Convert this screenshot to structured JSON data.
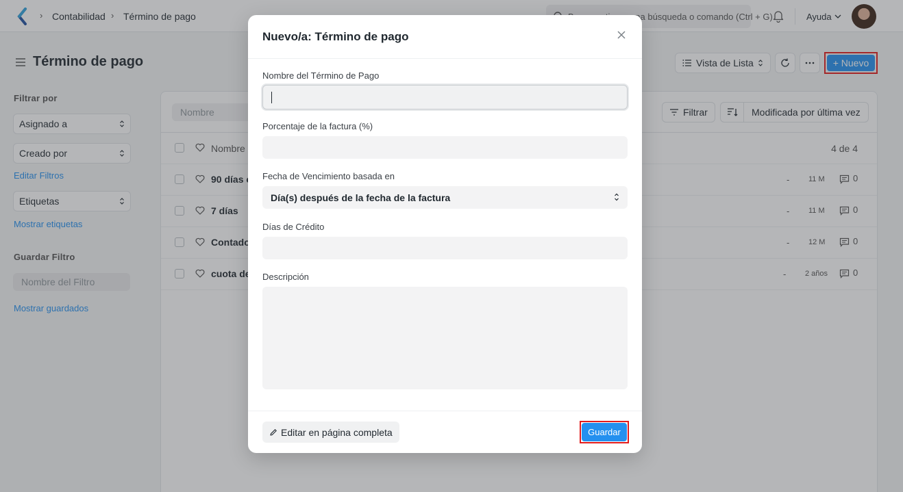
{
  "navbar": {
    "breadcrumbs": [
      "Contabilidad",
      "Término de pago"
    ],
    "search_placeholder": "Buscar o tipear una búsqueda o comando (Ctrl + G)",
    "help_label": "Ayuda"
  },
  "page": {
    "title": "Término de pago",
    "view_label": "Vista de Lista",
    "new_label": "+ Nuevo"
  },
  "sidebar": {
    "filter_by": "Filtrar por",
    "assigned_to": "Asignado a",
    "created_by": "Creado por",
    "edit_filters": "Editar Filtros",
    "tags": "Etiquetas",
    "show_tags": "Mostrar etiquetas",
    "save_filter": "Guardar Filtro",
    "filter_name_placeholder": "Nombre del Filtro",
    "show_saved": "Mostrar guardados"
  },
  "list": {
    "name_placeholder": "Nombre",
    "filter_label": "Filtrar",
    "sort_label": "Modificada por última vez",
    "header_title": "Nombre",
    "count": "4 de 4",
    "rows": [
      {
        "title": "90 días c",
        "dash": "-",
        "time": "11 M",
        "comments": "0"
      },
      {
        "title": "7 días",
        "dash": "-",
        "time": "11 M",
        "comments": "0"
      },
      {
        "title": "Contado",
        "dash": "-",
        "time": "12 M",
        "comments": "0"
      },
      {
        "title": "cuota de",
        "dash": "-",
        "time": "2 años",
        "comments": "0"
      }
    ]
  },
  "modal": {
    "title": "Nuevo/a: Término de pago",
    "fields": {
      "name_label": "Nombre del Término de Pago",
      "invoice_pct_label": "Porcentaje de la factura (%)",
      "due_date_label": "Fecha de Vencimiento basada en",
      "due_date_value": "Día(s) después de la fecha de la factura",
      "credit_days_label": "Días de Crédito",
      "description_label": "Descripción"
    },
    "edit_full_label": "Editar en página completa",
    "save_label": "Guardar"
  },
  "colors": {
    "primary": "#2490ef",
    "highlight": "#e21b1b"
  }
}
